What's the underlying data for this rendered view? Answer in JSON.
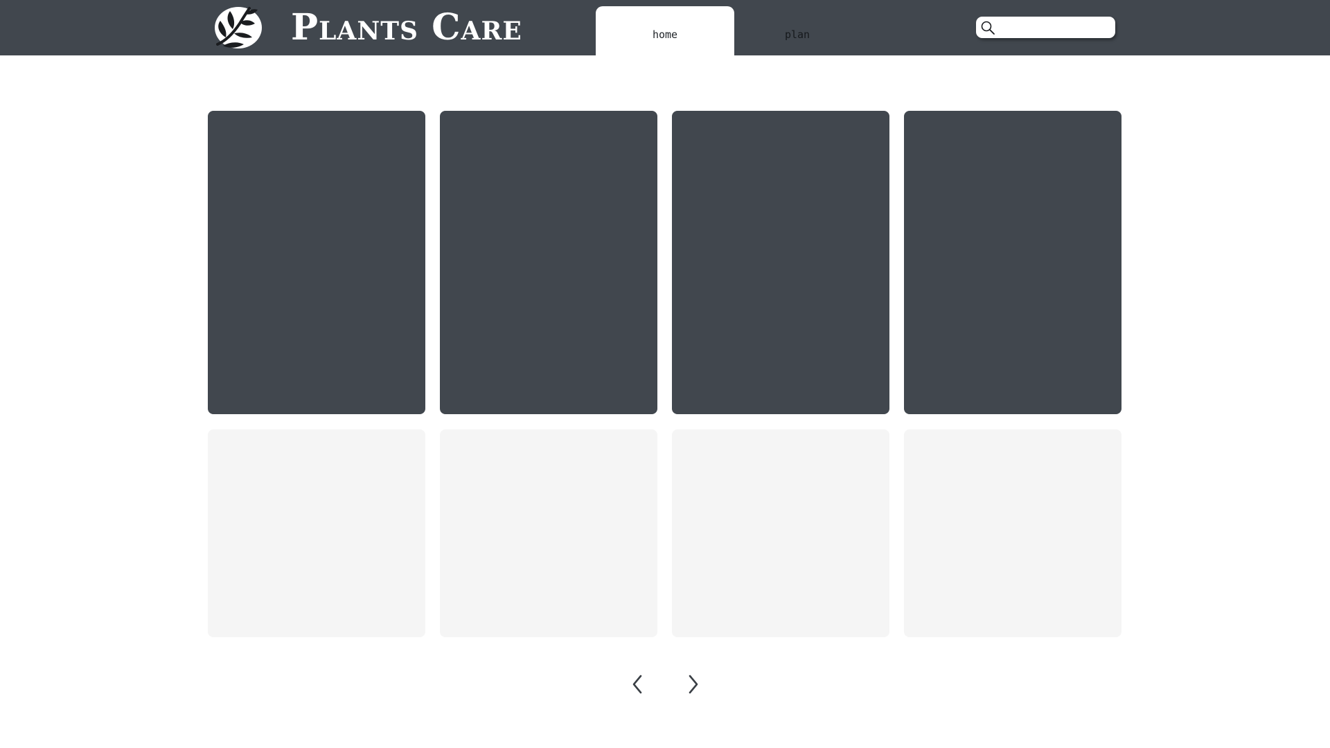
{
  "header": {
    "brand_name": "Plants Care",
    "logo_icon": "leaf-branch-logo-icon",
    "tabs": [
      {
        "label": "home",
        "active": true
      },
      {
        "label": "plan",
        "active": false
      }
    ],
    "search": {
      "value": "",
      "placeholder": "",
      "icon": "search-icon"
    }
  },
  "main": {
    "cards_top": [
      {},
      {},
      {},
      {}
    ],
    "cards_bottom": [
      {},
      {},
      {},
      {}
    ]
  },
  "pager": {
    "prev_icon": "chevron-left-icon",
    "next_icon": "chevron-right-icon"
  },
  "colors": {
    "header_bg": "#41474e",
    "dark_card": "#41474e",
    "light_card": "#f5f5f5",
    "page_bg": "#ffffff"
  }
}
